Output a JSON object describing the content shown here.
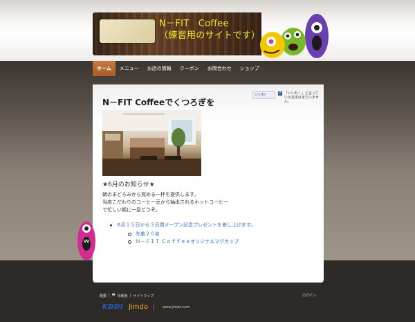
{
  "header": {
    "site_title_line1": "N－FIT　Coffee",
    "site_title_line2": "（練習用のサイトです）"
  },
  "nav": {
    "items": [
      {
        "label": "ホーム",
        "active": true
      },
      {
        "label": "メニュー",
        "active": false
      },
      {
        "label": "お店の情報",
        "active": false
      },
      {
        "label": "クーポン",
        "active": false
      },
      {
        "label": "お問合わせ",
        "active": false
      },
      {
        "label": "ショップ",
        "active": false
      }
    ]
  },
  "main": {
    "title": "N－FIT Coffeeでくつろぎを",
    "facebook": {
      "like_label": "いいね！",
      "prompt": "「いいね！」と言っている友達はまだいません。"
    },
    "notice_heading": "★6月のお知らせ★",
    "paragraph": [
      "朝のまどろみから覚める一杯を提供します。",
      "当店こだわりのコーヒー豆から抽出されるホットコーヒー",
      "で忙しい朝に一息どうぞ。"
    ],
    "bullet_main": "6月１５日から３日間オープン記念プレゼントを差し上げます。",
    "sub_bullets": [
      "先着２０名",
      "Ｎ－ＦＩＴ Ｃｏｆｆｅｅオリジナルマグカップ"
    ]
  },
  "footer": {
    "links": [
      "概要",
      "印刷用",
      "サイトマップ"
    ],
    "login": "ログイン",
    "kddi": "KDDI",
    "jimdo": "Jimdo",
    "jimdo_url": "www.jimdo.com"
  },
  "colors": {
    "title_yellow": "#f5e62a",
    "nav_active": "#b8642f",
    "link_blue": "#3a6fc8"
  }
}
